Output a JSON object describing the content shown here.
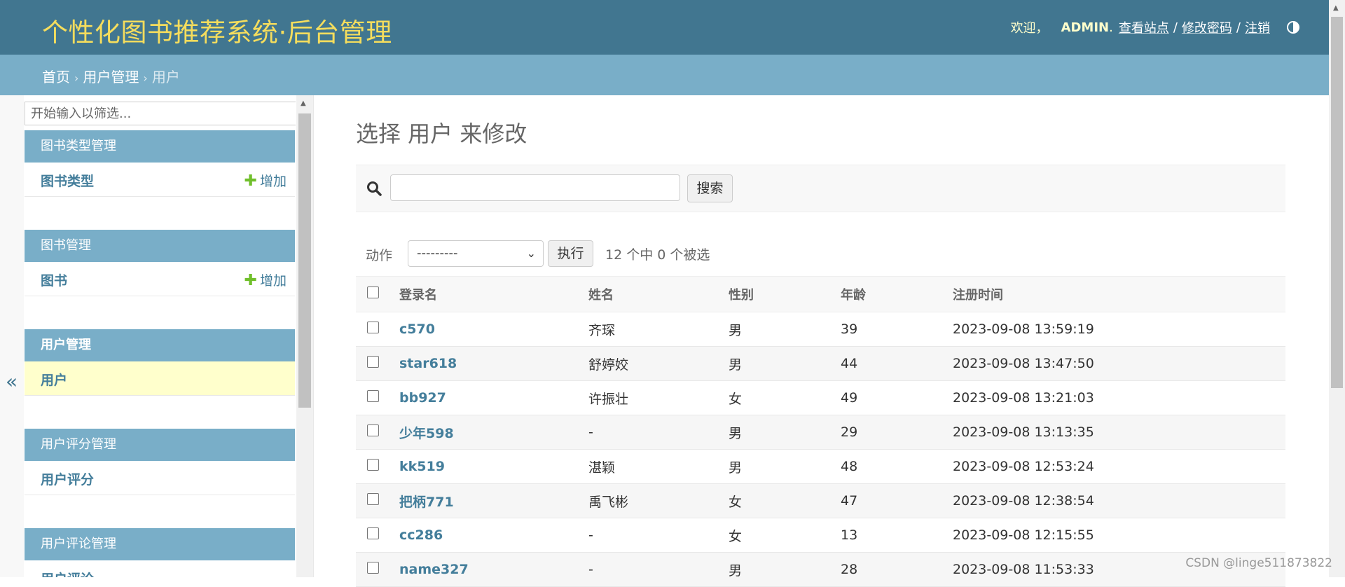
{
  "header": {
    "site_title": "个性化图书推荐系统·后台管理",
    "welcome": "欢迎，",
    "user_name": "ADMIN",
    "user_name_suffix": ".",
    "view_site": "查看站点",
    "change_password": "修改密码",
    "logout": "注销",
    "separator": "/"
  },
  "breadcrumbs": {
    "home": "首页",
    "section": "用户管理",
    "current": "用户",
    "arrow": "›"
  },
  "sidebar": {
    "collapse_glyph": "«",
    "filter_placeholder": "开始输入以筛选...",
    "add_label": "增加",
    "add_glyph": "✚",
    "apps": [
      {
        "caption": "图书类型管理",
        "model": "图书类型",
        "has_add": true
      },
      {
        "caption": "图书管理",
        "model": "图书",
        "has_add": true
      },
      {
        "caption": "用户管理",
        "model": "用户",
        "has_add": false,
        "active": true
      },
      {
        "caption": "用户评分管理",
        "model": "用户评分",
        "has_add": false
      },
      {
        "caption": "用户评论管理",
        "model": "用户评论",
        "has_add": false
      }
    ]
  },
  "main": {
    "title": "选择 用户 来修改",
    "search": {
      "value": "",
      "placeholder": "",
      "button": "搜索"
    },
    "actions": {
      "label": "动作",
      "selected_option": "---------",
      "run_button": "执行",
      "counter": "12 个中 0 个被选"
    },
    "table": {
      "headers": [
        "登录名",
        "姓名",
        "性别",
        "年龄",
        "注册时间"
      ],
      "rows": [
        {
          "login": "c570",
          "name": "齐琛",
          "gender": "男",
          "age": "39",
          "registered": "2023-09-08 13:59:19"
        },
        {
          "login": "star618",
          "name": "舒婷姣",
          "gender": "男",
          "age": "44",
          "registered": "2023-09-08 13:47:50"
        },
        {
          "login": "bb927",
          "name": "许振壮",
          "gender": "女",
          "age": "49",
          "registered": "2023-09-08 13:21:03"
        },
        {
          "login": "少年598",
          "name": "-",
          "gender": "男",
          "age": "29",
          "registered": "2023-09-08 13:13:35"
        },
        {
          "login": "kk519",
          "name": "湛颖",
          "gender": "男",
          "age": "48",
          "registered": "2023-09-08 12:53:24"
        },
        {
          "login": "把柄771",
          "name": "禹飞彬",
          "gender": "女",
          "age": "47",
          "registered": "2023-09-08 12:38:54"
        },
        {
          "login": "cc286",
          "name": "-",
          "gender": "女",
          "age": "13",
          "registered": "2023-09-08 12:15:55"
        },
        {
          "login": "name327",
          "name": "-",
          "gender": "男",
          "age": "28",
          "registered": "2023-09-08 11:53:33"
        }
      ]
    }
  },
  "watermark": "CSDN @linge511873822",
  "colors": {
    "header_bg": "#417690",
    "breadcrumb_bg": "#79aec8",
    "title_yellow": "#f5dd5d",
    "link": "#447e9b",
    "add_green": "#70bf2b",
    "selected_row": "#ffffcc"
  }
}
